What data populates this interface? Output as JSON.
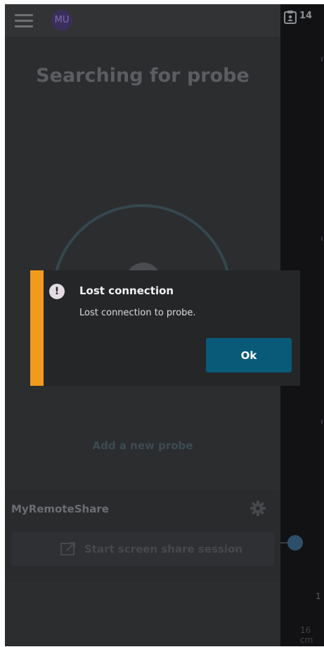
{
  "header": {
    "avatar_initials": "MU"
  },
  "drawer": {
    "title": "Searching for probe",
    "add_probe_label": "Add a new probe",
    "remote_share": {
      "title": "MyRemoteShare",
      "button_label": "Start screen share session"
    }
  },
  "background_app": {
    "patient_count": "14",
    "label_a": "1",
    "label_b": "16 cm"
  },
  "dialog": {
    "title": "Lost connection",
    "message": "Lost connection to probe.",
    "ok_label": "Ok",
    "accent_color": "#f39a1c",
    "button_color": "#085a78"
  },
  "icons": {
    "menu": "hamburger-menu-icon",
    "settings": "gear-icon",
    "screen_share": "screen-share-icon",
    "patient_list": "clipboard-icon",
    "alert": "exclamation-icon"
  }
}
